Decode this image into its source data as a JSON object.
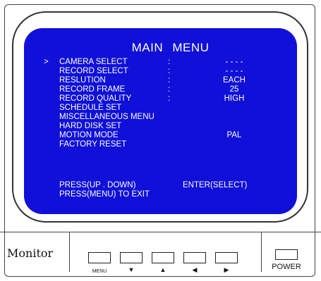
{
  "screen": {
    "title": "MAIN  MENU",
    "cursor": ">",
    "items": [
      {
        "label": "CAMERA SELECT",
        "colon": ":",
        "value": "- - - -"
      },
      {
        "label": "RECORD SELECT",
        "colon": ":",
        "value": "- - - -"
      },
      {
        "label": "RESLUTION",
        "colon": ":",
        "value": "EACH"
      },
      {
        "label": "RECORD FRAME",
        "colon": ":",
        "value": "25"
      },
      {
        "label": "RECORD QUALITY",
        "colon": ":",
        "value": "HIGH"
      },
      {
        "label": "SCHEDULE  SET",
        "colon": "",
        "value": ""
      },
      {
        "label": "MISCELLANEOUS  MENU",
        "colon": "",
        "value": ""
      },
      {
        "label": "HARD DISK SET",
        "colon": "",
        "value": ""
      },
      {
        "label": "MOTION  MODE",
        "colon": "",
        "value": "PAL"
      },
      {
        "label": "FACTORY  RESET",
        "colon": "",
        "value": ""
      }
    ],
    "instructions": {
      "line1_left": "PRESS(UP . DOWN)",
      "line1_right": "ENTER(SELECT)",
      "line2": "PRESS(MENU)  TO EXIT"
    }
  },
  "panel": {
    "brand": "Monitor",
    "buttons": [
      {
        "label": "MENU"
      },
      {
        "label": "▼"
      },
      {
        "label": "▲"
      },
      {
        "label": "◀"
      },
      {
        "label": "▶"
      }
    ],
    "power_label": "POWER"
  },
  "colors": {
    "screen_background": "#1010d8",
    "screen_text": "#ffffff"
  }
}
